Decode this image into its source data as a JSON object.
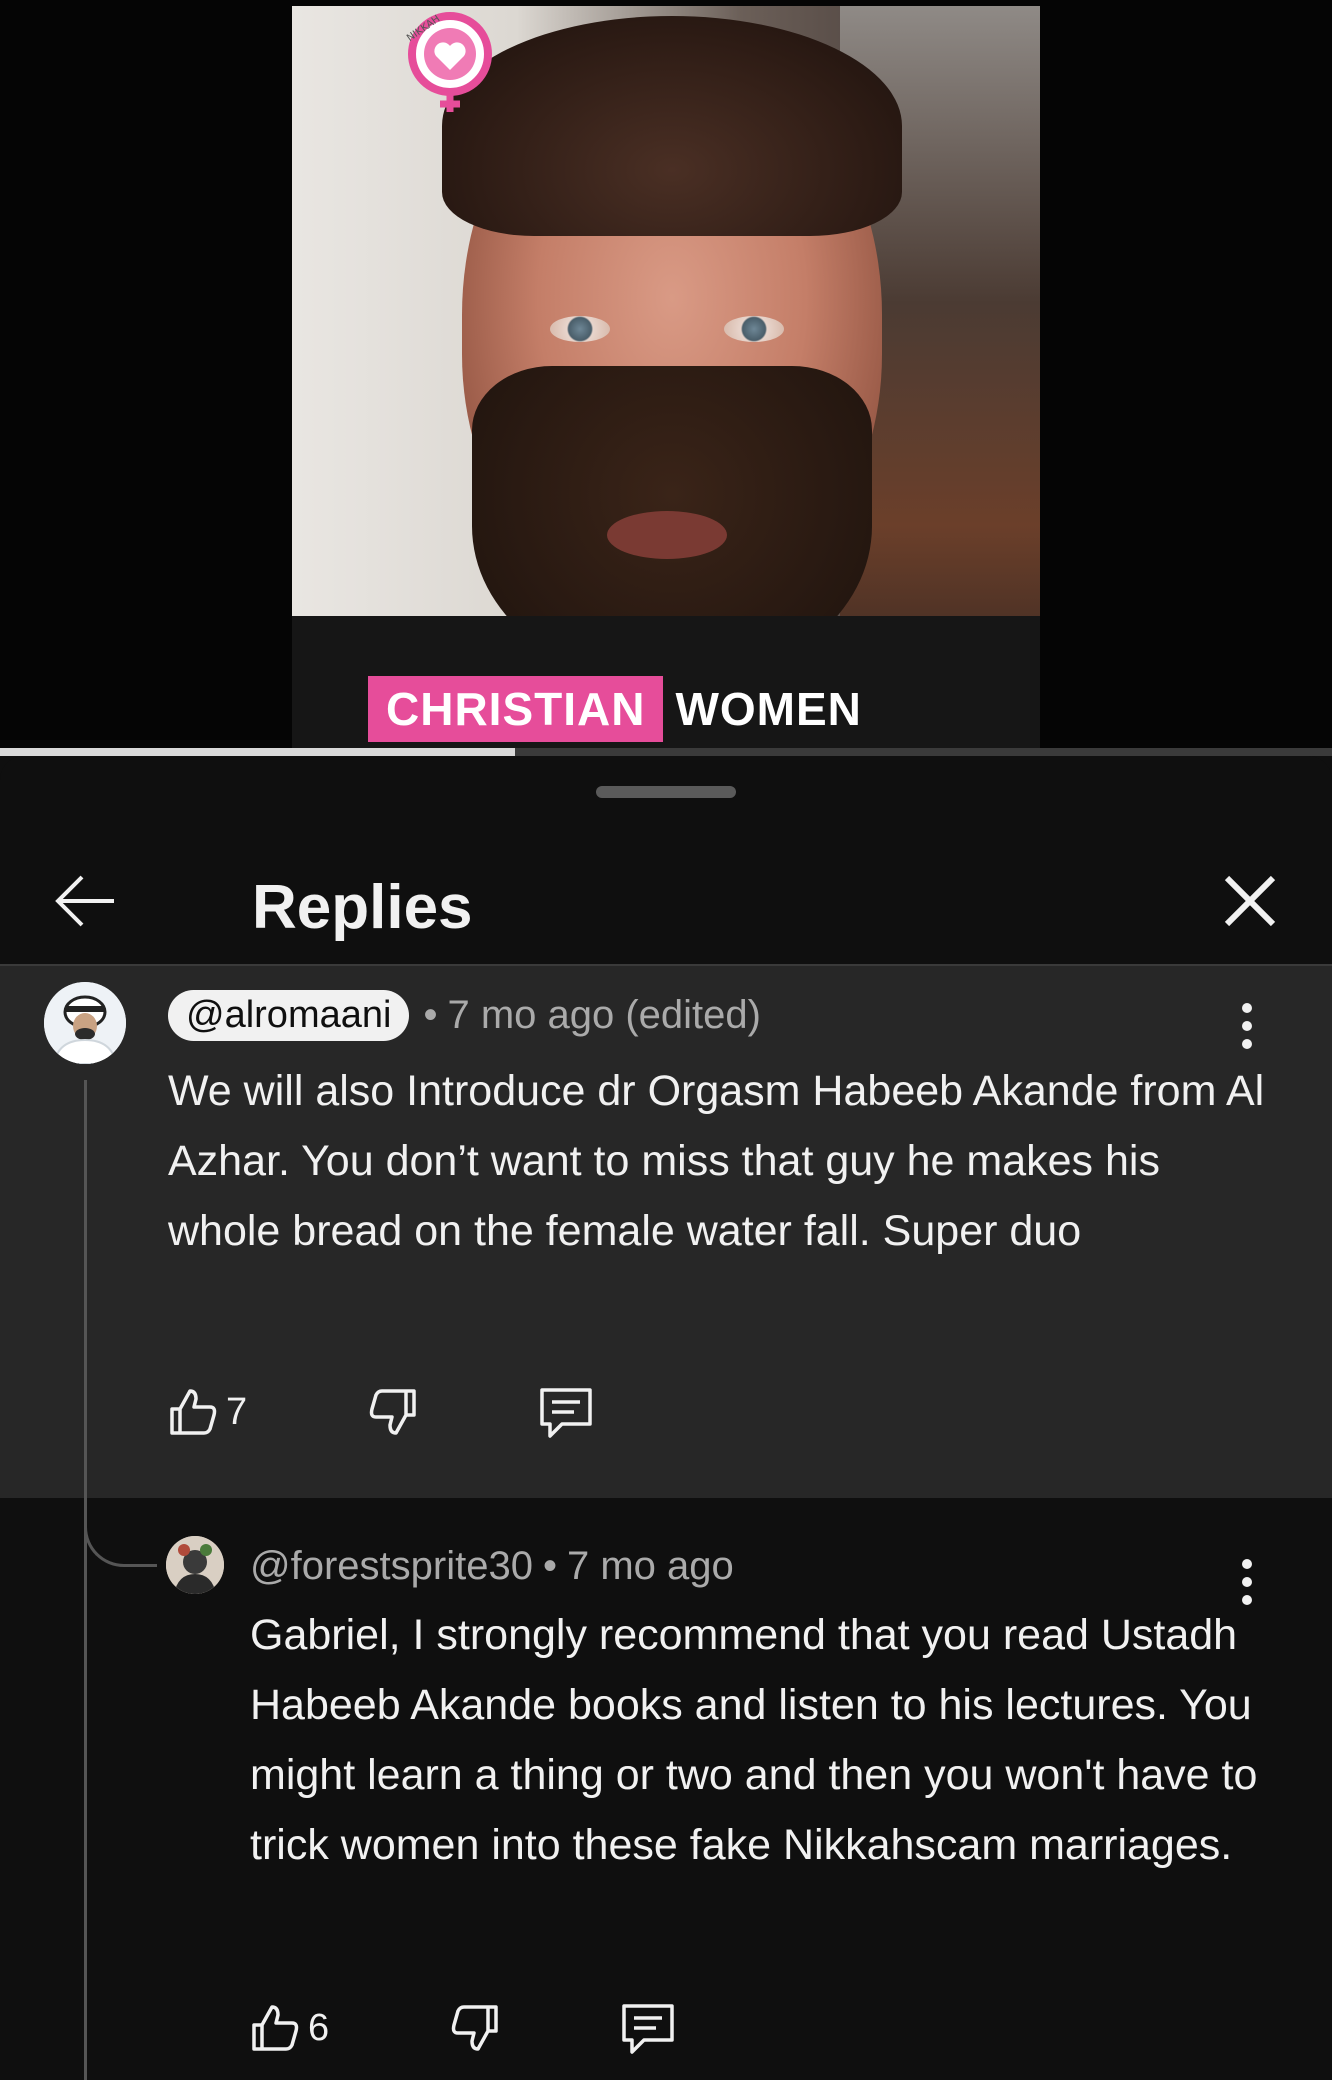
{
  "video": {
    "logo_text": "NIKKAH",
    "caption_highlight": "CHRISTIAN",
    "caption_rest": "WOMEN",
    "progress": 0.387
  },
  "sheet": {
    "title": "Replies"
  },
  "parent_comment": {
    "handle": "@alromaani",
    "separator": "•",
    "time": "7 mo ago (edited)",
    "text": "We will also Introduce dr Orgasm Habeeb Akande from Al Azhar. You don’t want to miss that guy he makes his whole bread on the female water fall. Super duo",
    "likes": "7"
  },
  "reply_comment": {
    "handle": "@forestsprite30",
    "separator": "•",
    "time": "7 mo ago",
    "text": "Gabriel, I strongly recommend that you read Ustadh Habeeb Akande books and listen to his lectures. You might learn a thing or two and then you won't have to trick women into these fake Nikkahscam marriages.",
    "likes": "6"
  },
  "icons": {
    "back": "arrow-left-icon",
    "close": "close-icon",
    "more": "more-vertical-icon",
    "like": "thumbs-up-icon",
    "dislike": "thumbs-down-icon",
    "reply": "comment-icon"
  },
  "colors": {
    "caption_highlight": "#e64d9a",
    "background": "#0f0f0f",
    "parent_bg": "#272727"
  }
}
